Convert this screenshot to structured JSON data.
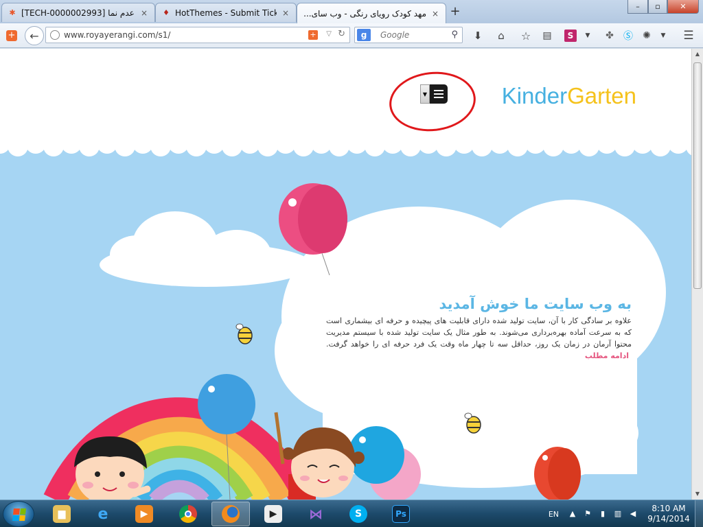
{
  "browser": {
    "tabs": [
      {
        "label": "[TECH-0000002993] عدم نما...",
        "close": "×",
        "icon": "joomla-icon"
      },
      {
        "label": "HotThemes - Submit Ticket",
        "close": "×",
        "icon": "hotthemes-icon"
      },
      {
        "label": "مهد کودک رویای رنگی - وب سای...",
        "close": "×",
        "icon": "page-icon",
        "active": true
      }
    ],
    "new_tab": "+",
    "window_controls": {
      "minimize": "–",
      "maximize": "▫",
      "close": "✕"
    },
    "url": "www.royayerangi.com/s1/",
    "search_engine": "g",
    "search_placeholder": "Google"
  },
  "page": {
    "logo_part1": "Kinder",
    "logo_part2": "Garten",
    "welcome_title": "به وب سایت ما خوش آمدید",
    "welcome_text": "علاوه بر سادگی کار با آن، سایت تولید شده دارای قابلیت های پیچیده و حرفه ای بیشماری است که به سرعت آماده بهره‌برداری می‌شوند. به طور مثال یک سایت تولید شده با سیستم مدیریت محتوا آرمان در زمان یک روز، حداقل سه تا چهار ماه وقت یک فرد حرفه ای را خواهد گرفت.",
    "read_more": "ادامه مطلب",
    "colors": {
      "sky": "#a6d5f3",
      "logo_blue": "#46b0e0",
      "logo_yellow": "#f5c21c",
      "title_blue": "#5bb6e4",
      "link_pink": "#e5547e",
      "annotation_red": "#e0181b"
    }
  },
  "taskbar": {
    "apps": [
      "file-explorer-icon",
      "internet-explorer-icon",
      "media-player-icon",
      "chrome-icon",
      "firefox-icon",
      "media-play-icon",
      "visual-studio-icon",
      "skype-icon",
      "photoshop-icon"
    ],
    "language": "EN",
    "time": "8:10 AM",
    "date": "9/14/2014"
  }
}
